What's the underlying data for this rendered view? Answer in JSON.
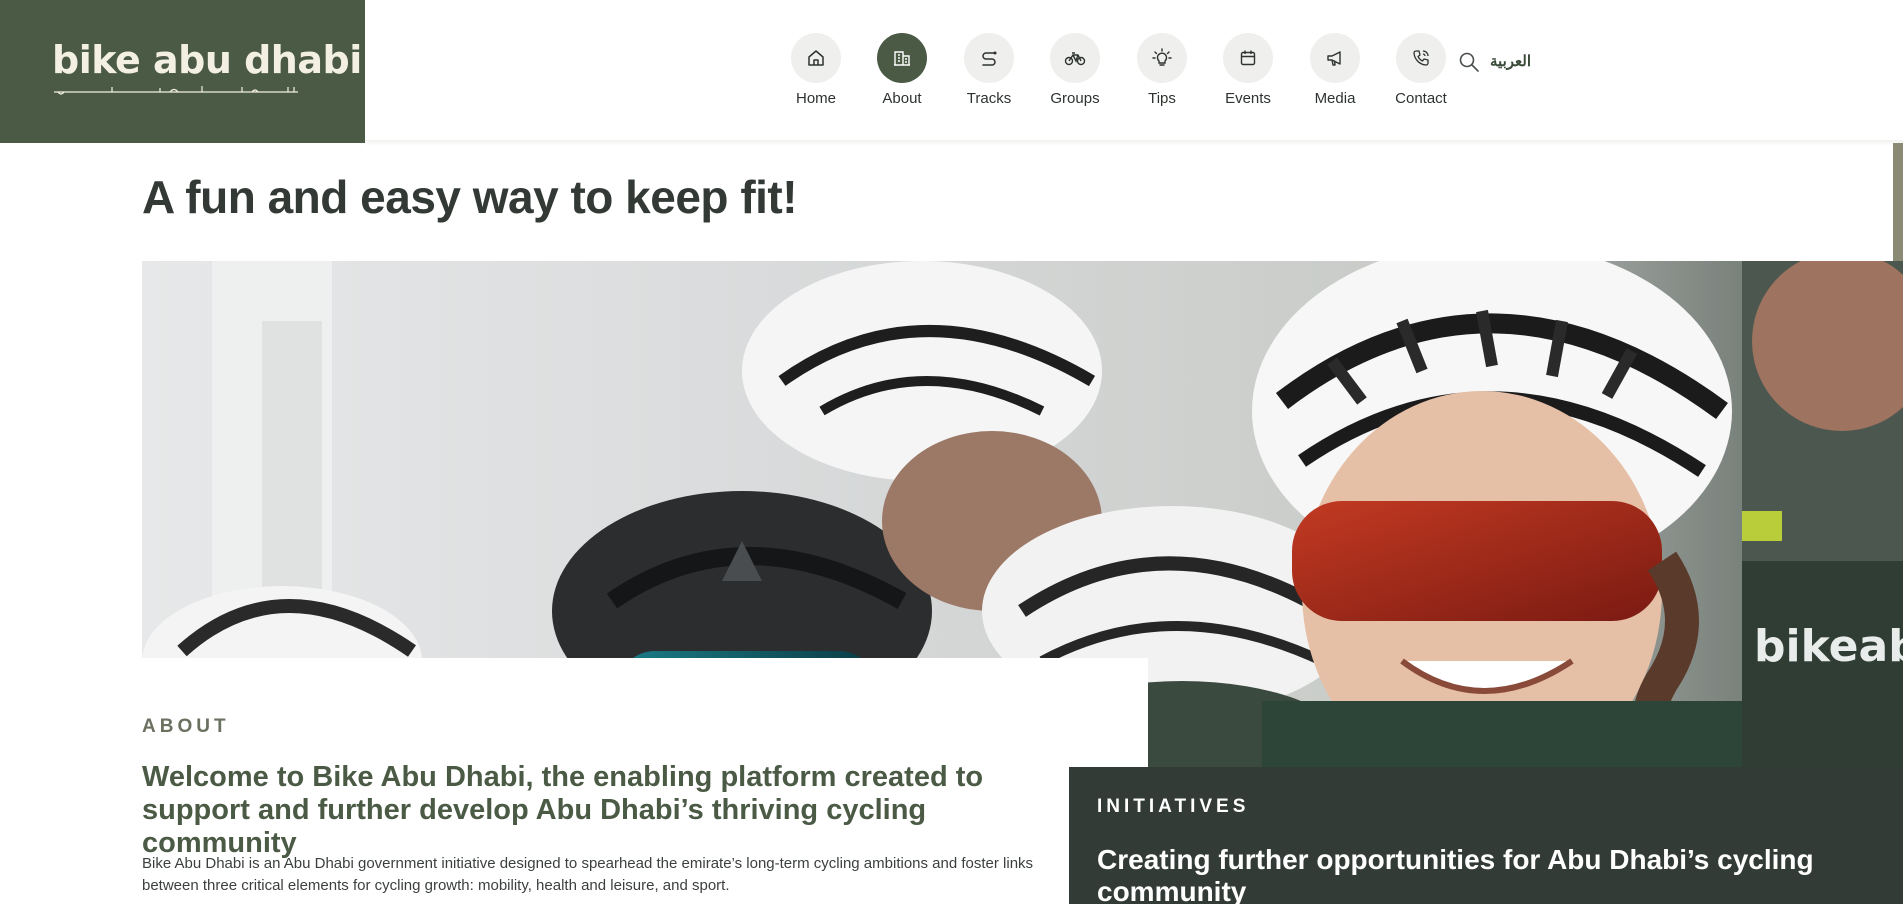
{
  "header": {
    "logo_text": "bike abu dhabi",
    "search_icon": "search-icon",
    "language_link": "العربية"
  },
  "nav": {
    "items": [
      {
        "label": "Home",
        "icon": "home-icon"
      },
      {
        "label": "About",
        "icon": "building-icon",
        "active": true
      },
      {
        "label": "Tracks",
        "icon": "route-icon"
      },
      {
        "label": "Groups",
        "icon": "bicycle-icon"
      },
      {
        "label": "Tips",
        "icon": "lightbulb-icon"
      },
      {
        "label": "Events",
        "icon": "calendar-icon"
      },
      {
        "label": "Media",
        "icon": "megaphone-icon"
      },
      {
        "label": "Contact",
        "icon": "phone-icon"
      }
    ]
  },
  "hero": {
    "title": "A fun and easy way to keep fit!",
    "jersey_text": "bikeabud"
  },
  "about": {
    "eyebrow": "ABOUT",
    "heading": "Welcome to Bike Abu Dhabi, the enabling platform created to support and further develop Abu Dhabi’s thriving cycling community",
    "body": "Bike Abu Dhabi is an Abu Dhabi government initiative designed to spearhead the emirate’s long-term cycling ambitions and foster links between three critical elements for cycling growth: mobility, health and leisure, and sport."
  },
  "initiatives": {
    "eyebrow": "INITIATIVES",
    "heading": "Creating further opportunities for Abu Dhabi’s cycling community"
  },
  "colors": {
    "brand_green": "#4a5a45",
    "dark_panel": "#333b36",
    "nav_circle": "#efefed",
    "logo_cream": "#f3efe2"
  }
}
